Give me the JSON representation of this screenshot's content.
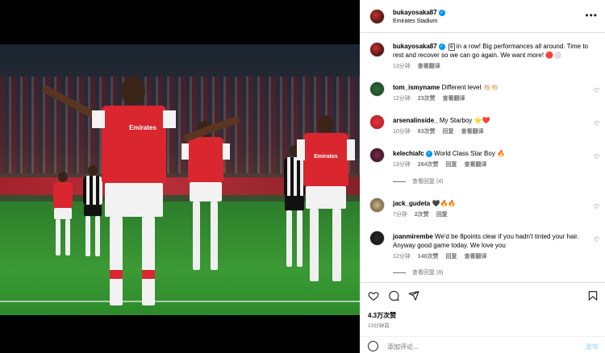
{
  "post": {
    "author": "bukayosaka87",
    "location": "Emirates Stadium",
    "caption_text": "in a row! Big performances all around. Time to rest and recover so we can go again. We want more!",
    "caption_badge": "6",
    "caption_emoji": "🔴⚪",
    "caption_time": "13分钟",
    "caption_translate": "查看翻译",
    "likes": "4.3万次赞",
    "posted": "13分钟前",
    "comment_placeholder": "添加评论...",
    "post_label": "发布"
  },
  "comments": [
    {
      "user": "tom_ismyname",
      "verified": false,
      "text": "Different level 👏🏻👏🏻",
      "time": "12分钟",
      "likes": "23次赞",
      "reply": "",
      "translate": "查看翻译",
      "replies": ""
    },
    {
      "user": "arsenalinside_",
      "verified": false,
      "text": "My Starboy ⭐️❤️",
      "time": "10分钟",
      "likes": "83次赞",
      "reply": "回复",
      "translate": "查看翻译",
      "replies": ""
    },
    {
      "user": "kelechiafc",
      "verified": true,
      "text": "World Class Star Boy 🔥",
      "time": "13分钟",
      "likes": "264次赞",
      "reply": "回复",
      "translate": "查看翻译",
      "replies": "查看回复 (4)"
    },
    {
      "user": "jack_gudeta",
      "verified": false,
      "text": "🖤🔥🔥",
      "time": "7分钟",
      "likes": "2次赞",
      "reply": "回复",
      "translate": "",
      "replies": ""
    },
    {
      "user": "joanmirembe",
      "verified": false,
      "text": "We'd be 8points clear if you hadn't tinted your hair. Anyway good game today. We love you",
      "time": "12分钟",
      "likes": "140次赞",
      "reply": "回复",
      "translate": "查看翻译",
      "replies": "查看回复 (8)"
    }
  ],
  "photo": {
    "sponsor": "Emirates\nFLY BETTER",
    "carousel_index": 0,
    "carousel_count": 3
  },
  "icons": [
    "more-icon",
    "heart-icon",
    "comment-icon",
    "share-icon",
    "bookmark-icon",
    "emoji-icon",
    "verified-icon"
  ],
  "colors": {
    "accent": "#0095f6",
    "muted": "#737373",
    "arsenal_red": "#d9262f"
  }
}
